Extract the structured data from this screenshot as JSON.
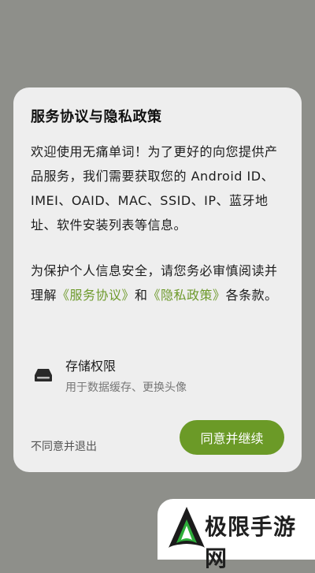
{
  "dialog": {
    "title": "服务协议与隐私政策",
    "intro": "欢迎使用无痛单词！为了更好的向您提供产品服务，我们需要获取您的 Android ID、IMEI、OAID、MAC、SSID、IP、蓝牙地址、软件安装列表等信息。",
    "notice_prefix": "为保护个人信息安全，请您务必审慎阅读并理解",
    "service_agreement_link": "《服务协议》",
    "notice_and": "和",
    "privacy_policy_link": "《隐私政策》",
    "notice_suffix": "各条款。",
    "permission": {
      "icon": "storage-icon",
      "title": "存储权限",
      "description": "用于数据缓存、更换头像"
    },
    "disagree_label": "不同意并退出",
    "agree_label": "同意并继续"
  },
  "watermark": {
    "text": "极限手游网",
    "logo_icon": "brand-logo-icon"
  },
  "colors": {
    "accent": "#6b9a27",
    "link": "#6e9a2c",
    "overlay": "#8e8f8a",
    "dialog_bg": "#eeeeee"
  }
}
